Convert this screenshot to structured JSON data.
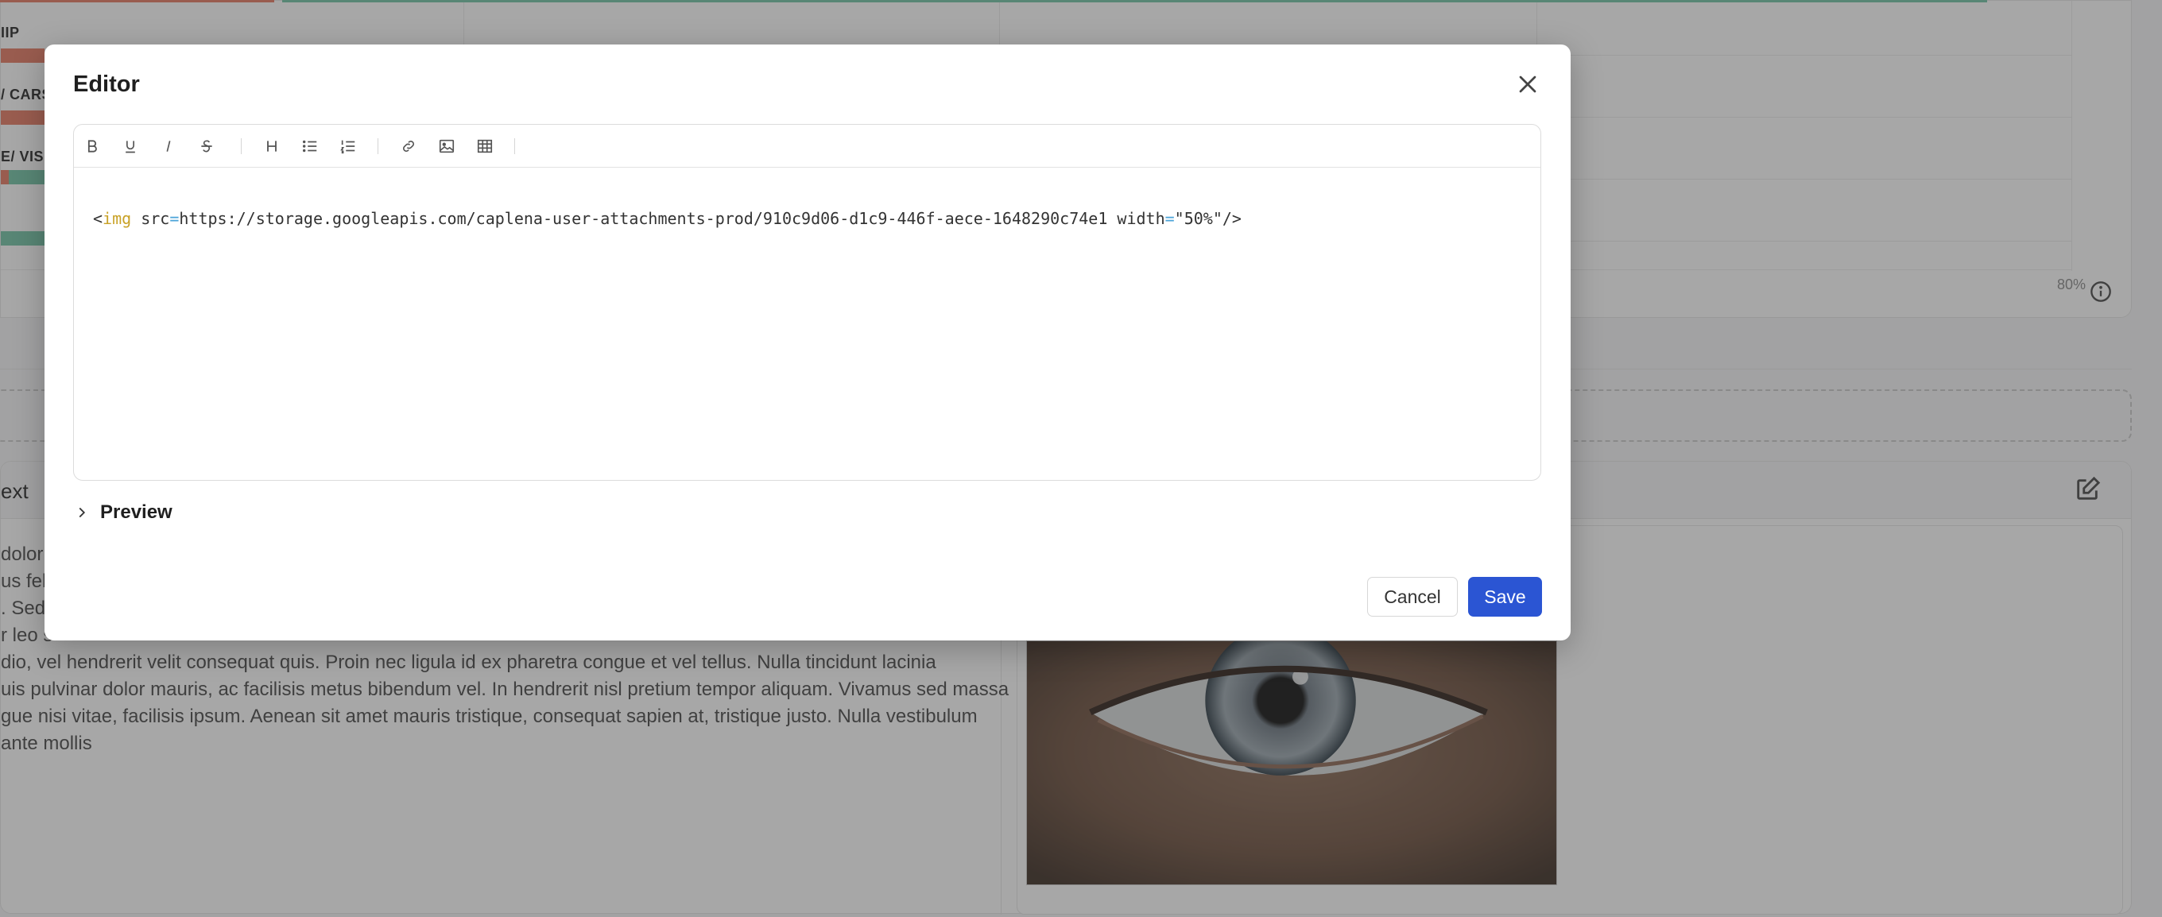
{
  "background": {
    "categories": [
      "IIP",
      "/ CARS",
      "E/ VISIT"
    ],
    "percent_label": "80%",
    "card_title": "ext",
    "text_lines": [
      "dolor",
      "us feli",
      ". Sed",
      "r leo s",
      "dio, vel hendrerit velit consequat quis. Proin nec ligula id ex pharetra congue et vel tellus. Nulla tincidunt lacinia",
      "uis pulvinar dolor mauris, ac facilisis metus bibendum vel. In hendrerit nisl pretium tempor aliquam. Vivamus sed massa",
      "gue nisi vitae, facilisis ipsum. Aenean sit amet mauris tristique, consequat sapien at, tristique justo. Nulla vestibulum",
      " ante mollis"
    ],
    "colors": {
      "red_bar": "#e5775f",
      "green_bar": "#6fc3a4"
    }
  },
  "modal": {
    "title": "Editor",
    "toolbar": [
      {
        "name": "bold-icon",
        "glyph": "B"
      },
      {
        "name": "underline-icon",
        "glyph": "U"
      },
      {
        "name": "italic-icon",
        "glyph": "I"
      },
      {
        "name": "strikethrough-icon",
        "glyph": "S"
      },
      {
        "name": "heading-icon",
        "glyph": "H"
      },
      {
        "name": "bullet-list-icon",
        "glyph": ""
      },
      {
        "name": "ordered-list-icon",
        "glyph": ""
      },
      {
        "name": "link-icon",
        "glyph": ""
      },
      {
        "name": "image-icon",
        "glyph": ""
      },
      {
        "name": "table-icon",
        "glyph": ""
      }
    ],
    "content": {
      "open": "<",
      "tag": "img",
      "attr1": " src",
      "eq1": "=",
      "val1": "https://storage.googleapis.com/caplena-user-attachments-prod/910c9d06-d1c9-446f-aece-1648290c74e1",
      "attr2": " width",
      "eq2": "=",
      "val2": "\"50%\"",
      "close": "/>"
    },
    "preview_label": "Preview",
    "cancel_label": "Cancel",
    "save_label": "Save",
    "colors": {
      "primary": "#2b55d3"
    }
  }
}
